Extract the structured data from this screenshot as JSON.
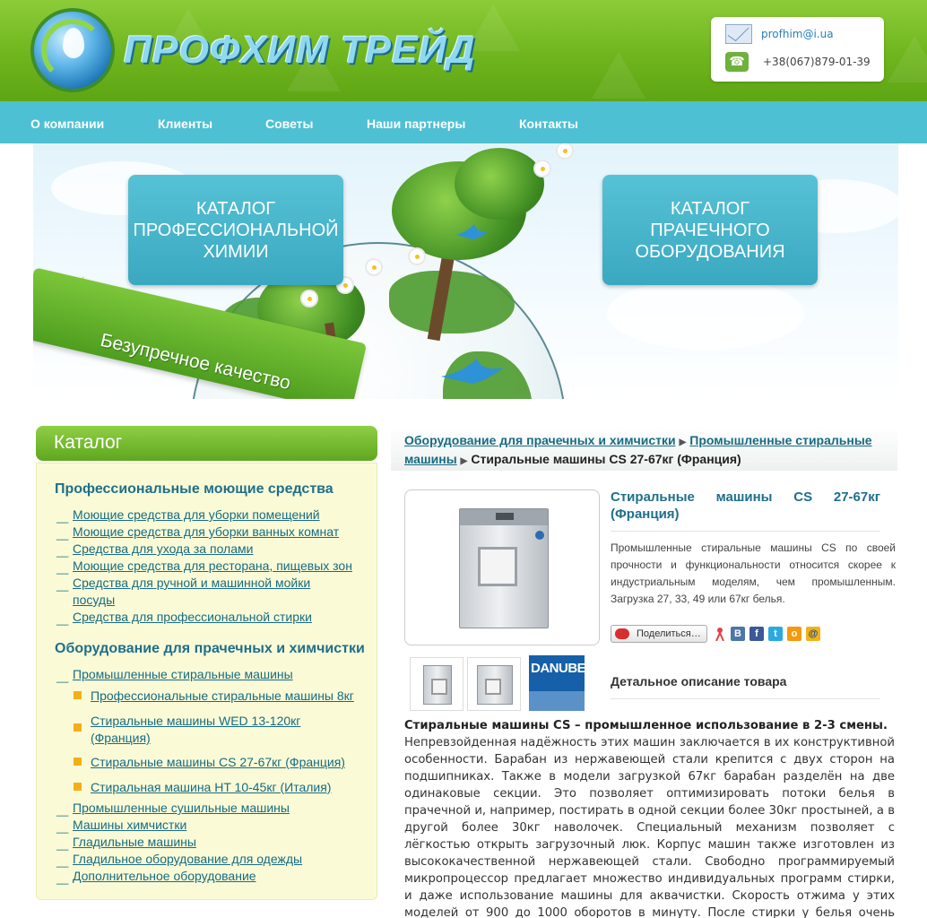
{
  "header": {
    "logo_text": "ПРОФХИМ ТРЕЙД",
    "email": "profhim@i.ua",
    "phone": "+38(067)879-01-39"
  },
  "nav": {
    "items": [
      "О компании",
      "Клиенты",
      "Советы",
      "Наши партнеры",
      "Контакты"
    ]
  },
  "banner": {
    "catalog_chemistry": "КАТАЛОГ ПРОФЕССИОНАЛЬНОЙ ХИМИИ",
    "catalog_laundry": "КАТАЛОГ ПРАЧЕЧНОГО ОБОРУДОВАНИЯ",
    "ribbon": "Безупречное качество"
  },
  "sidebar": {
    "title": "Каталог",
    "section1": {
      "title": "Профессиональные моющие средства",
      "items": [
        "Моющие средства для уборки помещений",
        "Моющие средства для уборки ванных комнат",
        "Средства для ухода за полами",
        "Моющие средства для ресторана, пищевых зон",
        "Средства для ручной и машинной мойки посуды",
        "Средства для профессиональной стирки"
      ]
    },
    "section2": {
      "title": "Оборудование для прачечных и химчистки",
      "top_item": "Промышленные стиральные машины",
      "sub_items": [
        "Профессиональные стиральные машины 8кг",
        "Стиральные машины WED 13-120кг (Франция)",
        "Стиральные машины CS 27-67кг (Франция)",
        "Стиральная машина HT 10-45кг (Италия)"
      ],
      "items": [
        "Промышленные сушильные машины",
        "Машины химчистки",
        "Гладильные машины",
        "Гладильное оборудование для одежды",
        "Дополнительное оборудование"
      ]
    }
  },
  "breadcrumb": {
    "level1": "Оборудование для прачечных и химчистки",
    "level2": "Промышленные стиральные машины",
    "current": "Стиральные машины CS 27-67кг (Франция)"
  },
  "product": {
    "title": "Стиральные машины CS 27-67кг (Франция)",
    "description": "Промышленные стиральные машины CS по своей прочности и функциональности относится скорее к индустриальным моделям, чем промышленным. Загрузка 27, 33, 49 или 67кг белья.",
    "share_label": "Поделиться…",
    "thumb_brand": "DANUBE",
    "detail_title": "Детальное описание товара",
    "body_heading": "Стиральные машины CS – промышленное использование в 2-3 смены.",
    "body_text": "Непревзойденная надёжность этих машин заключается в их конструктивной особенности. Барабан из нержавеющей стали крепится с двух сторон на подшипниках. Также в модели загрузкой 67кг барабан разделён на две одинаковые секции. Это позволяет оптимизировать потоки белья в прачечной и, например, постирать в одной секции более 30кг простыней, а в другой более 30кг наволочек. Специальный механизм позволяет с лёгкостью открыть загрузочный люк. Корпус машин также изготовлен из высококачественной нержавеющей стали. Свободно программируемый микропроцессор предлагает множество индивидуальных программ стирки, и даже использование машины для аквачистки. Скорость отжима у этих моделей от 900 до 1000 оборотов в минуту. После стирки у белья очень низкая остаточная влажность, что даёт"
  },
  "social": [
    "В",
    "f",
    "t",
    "o",
    "@"
  ]
}
